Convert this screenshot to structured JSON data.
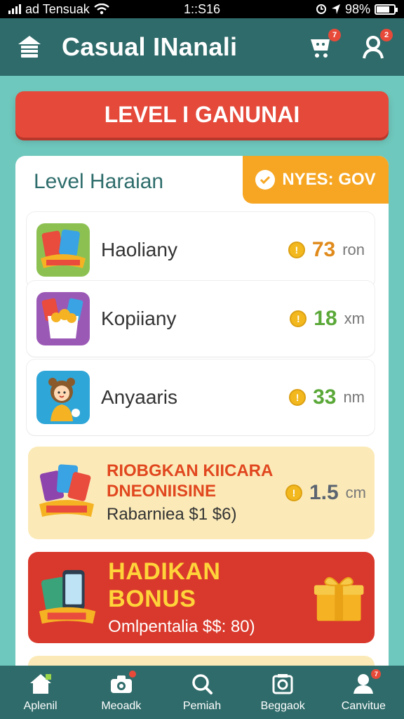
{
  "status_bar": {
    "carrier": "ad Tensuak",
    "time": "1::S16",
    "battery": "98%"
  },
  "header": {
    "title": "Casual INanali",
    "cart_badge": "7",
    "profile_badge": "2"
  },
  "level_banner": "LEVEL I GANUNAI",
  "card": {
    "title": "Level Haraian",
    "tag": "NYES: GOV",
    "rows": [
      {
        "name": "Haoliany",
        "amount": "73",
        "unit": "ron",
        "color": "#e08a1b"
      },
      {
        "name": "Kopiiany",
        "amount": "18",
        "unit": "xm",
        "color": "#5aa838"
      },
      {
        "name": "Anyaaris",
        "amount": "33",
        "unit": "nm",
        "color": "#5aa838"
      }
    ],
    "promo1": {
      "line1": "RIOBGKAN KIICARA",
      "line2": "DNEONIISINE",
      "line3": "Rabarniea $1 $6)",
      "amount": "1.5",
      "unit": "cm"
    },
    "promo2": {
      "line1": "HADIKAN BONUS",
      "line2": "Omlpentalia $$: 80)"
    }
  },
  "bottom_nav": [
    {
      "label": "Aplenil",
      "badge": ""
    },
    {
      "label": "Meoadk",
      "badge": ""
    },
    {
      "label": "Pemiah",
      "badge": ""
    },
    {
      "label": "Beggaok",
      "badge": ""
    },
    {
      "label": "Canvitue",
      "badge": "7"
    }
  ],
  "colors": {
    "teal_dark": "#2f6b6a",
    "teal_bg": "#6fc8bd",
    "red": "#e4493a",
    "orange": "#f6a623",
    "yellow": "#ffd43a"
  }
}
